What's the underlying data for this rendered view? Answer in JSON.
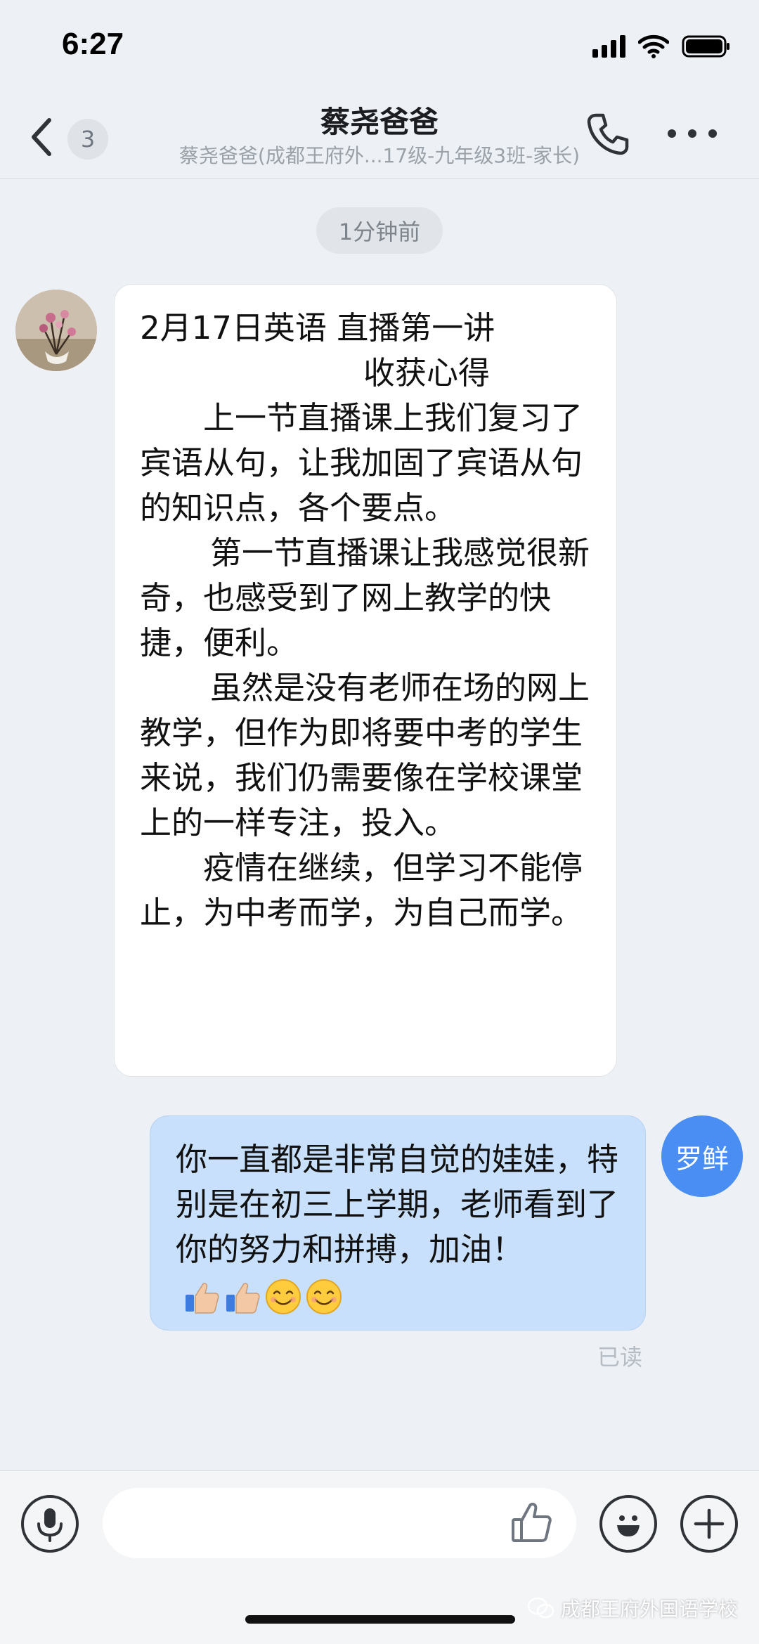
{
  "status_bar": {
    "time": "6:27"
  },
  "header": {
    "unread_count": "3",
    "title": "蔡尧爸爸",
    "subtitle": "蔡尧爸爸(成都王府外...17级-九年级3班-家长)"
  },
  "chat": {
    "timestamp": "1分钟前",
    "incoming": {
      "lines": [
        "2月17日英语 直播第一讲",
        "收获心得",
        "上一节直播课上我们复习了宾语从句，让我加固了宾语从句的知识点，各个要点。",
        "第一节直播课让我感觉很新奇，也感受到了网上教学的快捷，便利。",
        "虽然是没有老师在场的网上教学，但作为即将要中考的学生来说，我们仍需要像在学校课堂上的一样专注，投入。",
        "疫情在继续，但学习不能停止，为中考而学，为自己而学。"
      ]
    },
    "outgoing": {
      "text": "你一直都是非常自觉的娃娃，特别是在初三上学期，老师看到了你的努力和拼搏，加油！",
      "avatar_label": "罗鲜",
      "read_status": "已读",
      "emojis": [
        "thumbs-up",
        "thumbs-up",
        "smiling-face",
        "smiling-face"
      ]
    }
  },
  "watermark": "成都王府外国语学校",
  "colors": {
    "background": "#edf0f4",
    "outgoing_bubble": "#c8e0fb",
    "avatar_blue": "#4b8ef3"
  }
}
